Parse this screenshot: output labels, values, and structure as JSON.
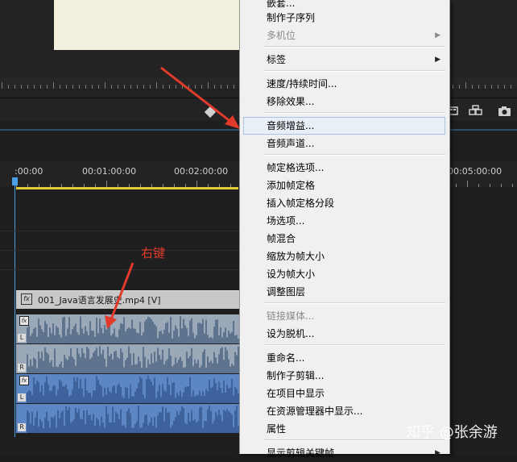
{
  "timeline": {
    "timecodes": [
      ":00:00",
      "00:01:00:00",
      "00:02:00:00",
      "00:05:00:00"
    ],
    "video_clip_label": "001_Java语言发展史.mp4 [V]",
    "fx_label": "fx",
    "channel_labels": [
      "L",
      "R",
      "L",
      "R"
    ]
  },
  "annotation": {
    "text": "右键",
    "color": "#e23a2b"
  },
  "context_menu": {
    "items": [
      {
        "label": "嵌套...",
        "disabled": false,
        "submenu": false
      },
      {
        "label": "制作子序列",
        "disabled": false,
        "submenu": false
      },
      {
        "label": "多机位",
        "disabled": true,
        "submenu": true
      },
      {
        "label": "标签",
        "disabled": false,
        "submenu": true
      },
      {
        "label": "速度/持续时间...",
        "disabled": false,
        "submenu": false
      },
      {
        "label": "移除效果...",
        "disabled": false,
        "submenu": false
      },
      {
        "label": "音频增益...",
        "disabled": false,
        "submenu": false,
        "highlight": true
      },
      {
        "label": "音频声道...",
        "disabled": false,
        "submenu": false
      },
      {
        "label": "帧定格选项...",
        "disabled": false,
        "submenu": false
      },
      {
        "label": "添加帧定格",
        "disabled": false,
        "submenu": false
      },
      {
        "label": "插入帧定格分段",
        "disabled": false,
        "submenu": false
      },
      {
        "label": "场选项...",
        "disabled": false,
        "submenu": false
      },
      {
        "label": "帧混合",
        "disabled": false,
        "submenu": false
      },
      {
        "label": "缩放为帧大小",
        "disabled": false,
        "submenu": false
      },
      {
        "label": "设为帧大小",
        "disabled": false,
        "submenu": false
      },
      {
        "label": "调整图层",
        "disabled": false,
        "submenu": false
      },
      {
        "label": "链接媒体...",
        "disabled": true,
        "submenu": false
      },
      {
        "label": "设为脱机...",
        "disabled": false,
        "submenu": false
      },
      {
        "label": "重命名...",
        "disabled": false,
        "submenu": false
      },
      {
        "label": "制作子剪辑...",
        "disabled": false,
        "submenu": false
      },
      {
        "label": "在项目中显示",
        "disabled": false,
        "submenu": false
      },
      {
        "label": "在资源管理器中显示...",
        "disabled": false,
        "submenu": false
      },
      {
        "label": "属性",
        "disabled": false,
        "submenu": false
      },
      {
        "label": "显示剪辑关键帧",
        "disabled": false,
        "submenu": true
      }
    ]
  },
  "watermark": "知乎 @张余游",
  "icons": {
    "submenu_arrow": "triangle-right-icon",
    "transport": [
      "film-strip-icon",
      "multi-camera-icon",
      "camera-icon"
    ]
  }
}
